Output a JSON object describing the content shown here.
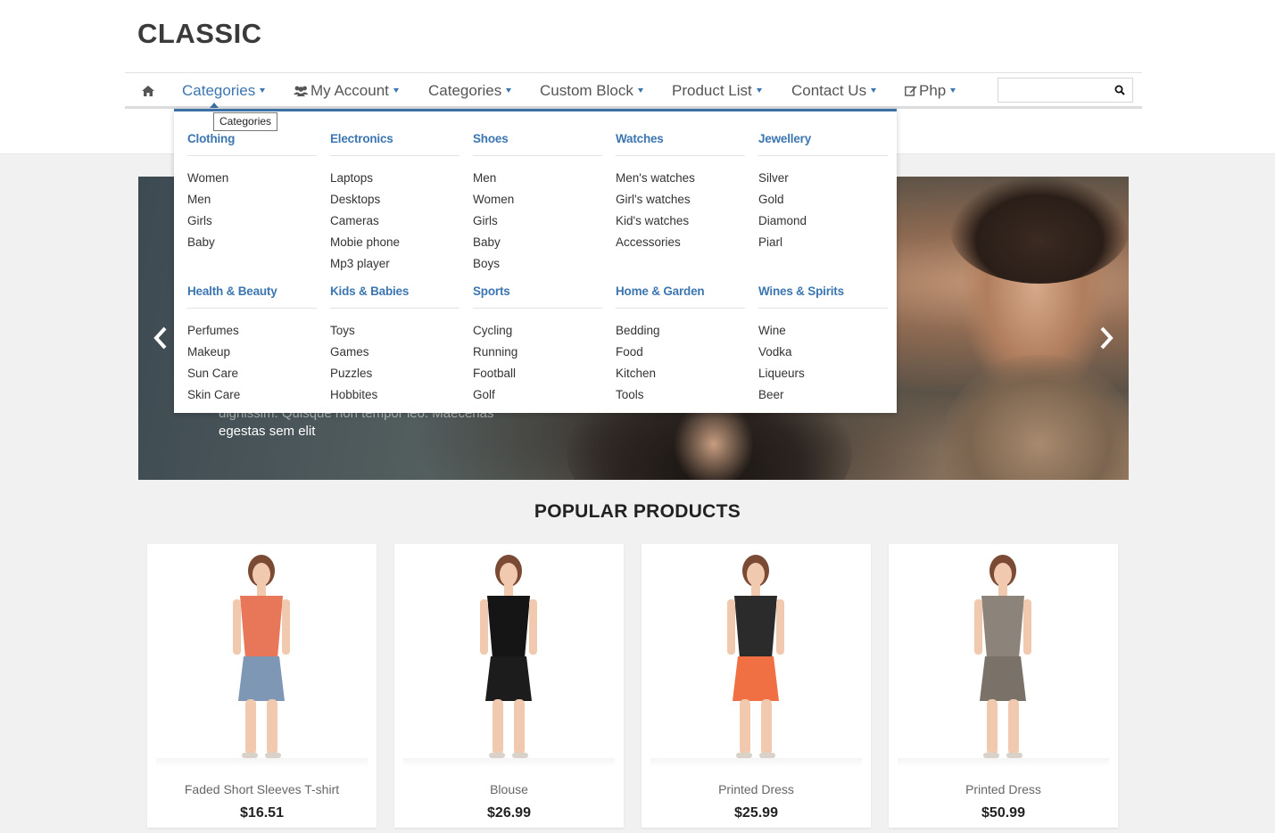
{
  "header": {
    "logo": "CLASSIC",
    "search": {
      "value": "",
      "placeholder": ""
    }
  },
  "nav": {
    "items": [
      {
        "label": "Categories",
        "active": true
      },
      {
        "label": "My Account",
        "icon": "users-icon"
      },
      {
        "label": "Categories"
      },
      {
        "label": "Custom Block"
      },
      {
        "label": "Product List"
      },
      {
        "label": "Contact Us"
      },
      {
        "label": "Php",
        "icon": "edit-icon"
      }
    ]
  },
  "tooltip": "Categories",
  "mega_menu": {
    "columns": [
      {
        "title": "Clothing",
        "links": [
          "Women",
          "Men",
          "Girls",
          "Baby"
        ]
      },
      {
        "title": "Electronics",
        "links": [
          "Laptops",
          "Desktops",
          "Cameras",
          "Mobie phone",
          "Mp3 player"
        ]
      },
      {
        "title": "Shoes",
        "links": [
          "Men",
          "Women",
          "Girls",
          "Baby",
          "Boys"
        ]
      },
      {
        "title": "Watches",
        "links": [
          "Men's watches",
          "Girl's watches",
          "Kid's watches",
          "Accessories"
        ]
      },
      {
        "title": "Jewellery",
        "links": [
          "Silver",
          "Gold",
          "Diamond",
          "Piarl"
        ]
      },
      {
        "title": "Health & Beauty",
        "links": [
          "Perfumes",
          "Makeup",
          "Sun Care",
          "Skin Care"
        ]
      },
      {
        "title": "Kids & Babies",
        "links": [
          "Toys",
          "Games",
          "Puzzles",
          "Hobbites"
        ]
      },
      {
        "title": "Sports",
        "links": [
          "Cycling",
          "Running",
          "Football",
          "Golf"
        ]
      },
      {
        "title": "Home & Garden",
        "links": [
          "Bedding",
          "Food",
          "Kitchen",
          "Tools"
        ]
      },
      {
        "title": "Wines & Spirits",
        "links": [
          "Wine",
          "Vodka",
          "Liqueurs",
          "Beer"
        ]
      }
    ]
  },
  "slider": {
    "caption_line1": "dignissim. Quisque non tempor leo. Maecenas",
    "caption_line2": "egestas sem elit"
  },
  "popular": {
    "title": "POPULAR PRODUCTS",
    "products": [
      {
        "name": "Faded Short Sleeves T-shirt",
        "price": "$16.51",
        "top": "#e8775a",
        "bottom": "#7d97b4"
      },
      {
        "name": "Blouse",
        "price": "$26.99",
        "top": "#151515",
        "bottom": "#1c1c1c"
      },
      {
        "name": "Printed Dress",
        "price": "$25.99",
        "top": "#2b2b2b",
        "bottom": "#f07044"
      },
      {
        "name": "Printed Dress",
        "price": "$50.99",
        "top": "#8c847a",
        "bottom": "#7a7268"
      }
    ]
  }
}
